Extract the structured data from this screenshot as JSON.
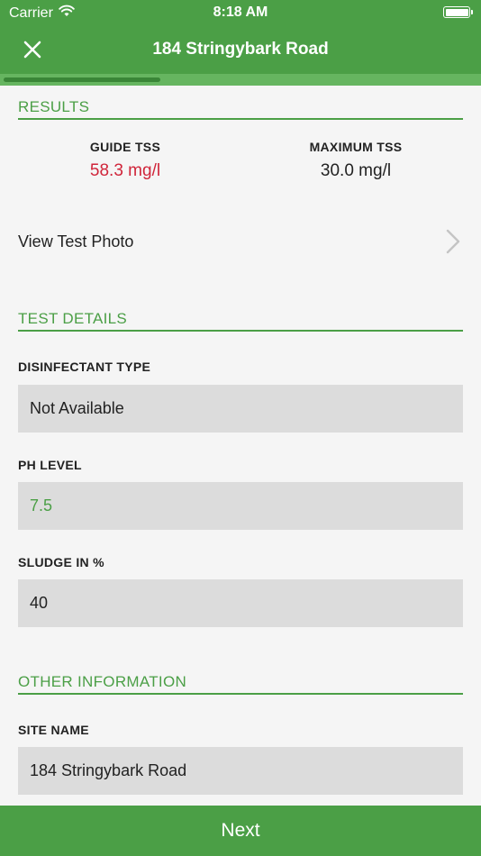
{
  "status_bar": {
    "carrier": "Carrier",
    "time": "8:18 AM",
    "wifi_icon": "wifi-icon",
    "battery_icon": "battery-icon"
  },
  "nav": {
    "title": "184 Stringybark Road",
    "close_icon": "close-icon",
    "progress_fraction": 0.33
  },
  "results": {
    "section_title": "RESULTS",
    "guide_label": "GUIDE TSS",
    "guide_value": "58.3 mg/l",
    "max_label": "MAXIMUM TSS",
    "max_value": "30.0 mg/l",
    "view_photo_label": "View Test Photo",
    "chevron_icon": "chevron-right-icon"
  },
  "test_details": {
    "section_title": "TEST DETAILS",
    "disinfectant_label": "DISINFECTANT TYPE",
    "disinfectant_value": "Not Available",
    "ph_label": "PH LEVEL",
    "ph_value": "7.5",
    "sludge_label": "SLUDGE IN %",
    "sludge_value": "40"
  },
  "other_info": {
    "section_title": "OTHER INFORMATION",
    "site_name_label": "SITE NAME",
    "site_name_value": "184 Stringybark Road"
  },
  "footer": {
    "next_label": "Next"
  },
  "colors": {
    "primary_green": "#4b9f46",
    "alert_red": "#d0253a",
    "field_gray": "#dcdcdc",
    "background": "#f5f5f5"
  }
}
